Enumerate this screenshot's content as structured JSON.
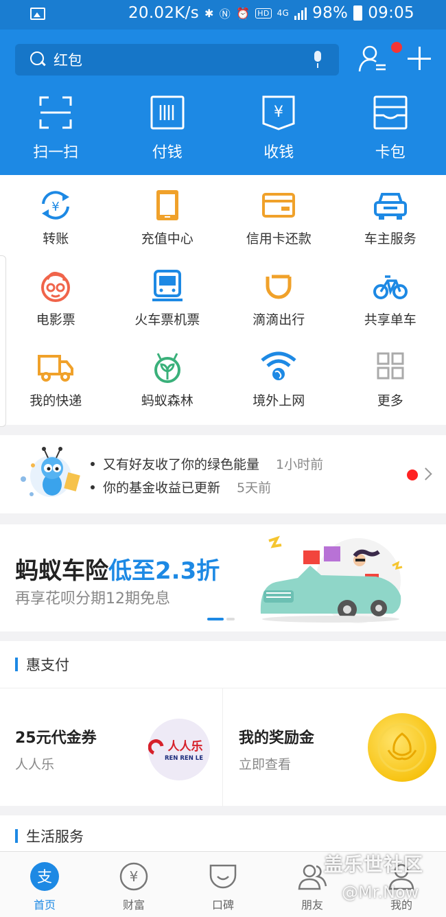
{
  "status_bar": {
    "speed": "20.02K/s",
    "network": "4G",
    "battery": "98%",
    "time": "09:05",
    "icons": [
      "image-icon",
      "bluetooth-icon",
      "nfc-icon",
      "alarm-icon",
      "hd-icon",
      "signal-icon",
      "battery-icon"
    ]
  },
  "search": {
    "placeholder": "红包"
  },
  "header_actions": {
    "contacts_icon": "contacts-icon",
    "plus_icon": "plus-icon",
    "has_badge": true
  },
  "main_actions": [
    {
      "label": "扫一扫",
      "icon": "scan-icon"
    },
    {
      "label": "付钱",
      "icon": "pay-icon"
    },
    {
      "label": "收钱",
      "icon": "receive-icon"
    },
    {
      "label": "卡包",
      "icon": "card-wallet-icon"
    }
  ],
  "grid": [
    {
      "label": "转账",
      "icon": "transfer-icon",
      "color": "#1d89e4"
    },
    {
      "label": "充值中心",
      "icon": "phone-recharge-icon",
      "color": "#f0a12a"
    },
    {
      "label": "信用卡还款",
      "icon": "credit-card-icon",
      "color": "#f0a12a"
    },
    {
      "label": "车主服务",
      "icon": "car-icon",
      "color": "#1d89e4"
    },
    {
      "label": "电影票",
      "icon": "movie-icon",
      "color": "#f0644a"
    },
    {
      "label": "火车票机票",
      "icon": "train-icon",
      "color": "#1d89e4"
    },
    {
      "label": "滴滴出行",
      "icon": "didi-icon",
      "color": "#f0a12a"
    },
    {
      "label": "共享单车",
      "icon": "bike-icon",
      "color": "#1d89e4"
    },
    {
      "label": "我的快递",
      "icon": "truck-icon",
      "color": "#f0a12a"
    },
    {
      "label": "蚂蚁森林",
      "icon": "forest-icon",
      "color": "#3ab07a"
    },
    {
      "label": "境外上网",
      "icon": "wifi-globe-icon",
      "color": "#1d89e4"
    },
    {
      "label": "更多",
      "icon": "more-grid-icon",
      "color": "#aaaaaa"
    }
  ],
  "notice": {
    "items": [
      {
        "text": "又有好友收了你的绿色能量",
        "time": "1小时前"
      },
      {
        "text": "你的基金收益已更新",
        "time": "5天前"
      }
    ]
  },
  "banner": {
    "title_part1": "蚂蚁车险",
    "title_part2": "低至2.3折",
    "subtitle": "再享花呗分期12期免息"
  },
  "hui_pay": {
    "title": "惠支付",
    "cards": [
      {
        "title": "25元代金券",
        "subtitle": "人人乐",
        "logo_text": "人人乐",
        "logo_sub": "REN REN LE"
      },
      {
        "title": "我的奖励金",
        "subtitle": "立即查看"
      }
    ]
  },
  "life_services": {
    "title": "生活服务"
  },
  "tabbar": [
    {
      "label": "首页",
      "icon": "alipay-home-icon",
      "active": true
    },
    {
      "label": "财富",
      "icon": "wealth-icon",
      "active": false
    },
    {
      "label": "口碑",
      "icon": "koubei-icon",
      "active": false
    },
    {
      "label": "朋友",
      "icon": "friends-icon",
      "active": false
    },
    {
      "label": "我的",
      "icon": "me-icon",
      "active": false
    }
  ],
  "watermark": {
    "line1": "盖乐世社区",
    "line2": "@Mr.Now"
  },
  "colors": {
    "brand_blue": "#1d89e4",
    "badge_red": "#f43535",
    "orange": "#f0a12a"
  }
}
